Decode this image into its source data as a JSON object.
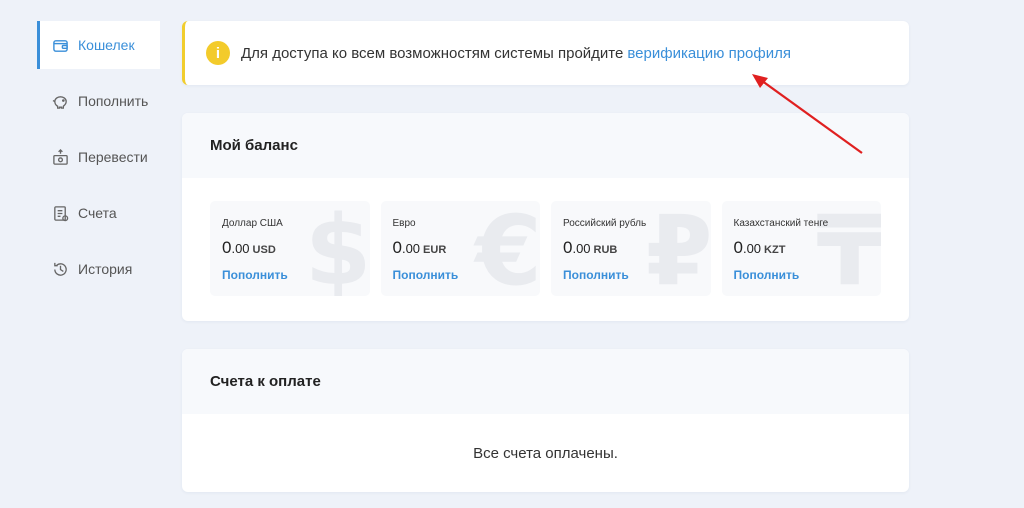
{
  "sidebar": {
    "items": [
      {
        "label": "Кошелек",
        "icon": "wallet-icon",
        "active": true
      },
      {
        "label": "Пополнить",
        "icon": "piggy-bank-icon"
      },
      {
        "label": "Перевести",
        "icon": "transfer-icon"
      },
      {
        "label": "Счета",
        "icon": "invoice-icon"
      },
      {
        "label": "История",
        "icon": "history-icon"
      }
    ]
  },
  "alert": {
    "icon": "i",
    "text": "Для доступа ко всем возможностям системы пройдите",
    "link": "верификацию профиля",
    "accent": "#f1cd2d"
  },
  "balance": {
    "title": "Мой баланс",
    "currencies": [
      {
        "name": "Доллар США",
        "int": "0",
        "dec": ".00",
        "code": "USD",
        "action": "Пополнить",
        "symbol": "$"
      },
      {
        "name": "Евро",
        "int": "0",
        "dec": ".00",
        "code": "EUR",
        "action": "Пополнить",
        "symbol": "€"
      },
      {
        "name": "Российский рубль",
        "int": "0",
        "dec": ".00",
        "code": "RUB",
        "action": "Пополнить",
        "symbol": "₽"
      },
      {
        "name": "Казахстанский тенге",
        "int": "0",
        "dec": ".00",
        "code": "KZT",
        "action": "Пополнить",
        "symbol": "₸"
      }
    ]
  },
  "invoices": {
    "title": "Счета к оплате",
    "empty": "Все счета оплачены."
  },
  "colors": {
    "accent": "#3a8fd9",
    "background": "#eef2f9",
    "annotation": "#e02020"
  }
}
